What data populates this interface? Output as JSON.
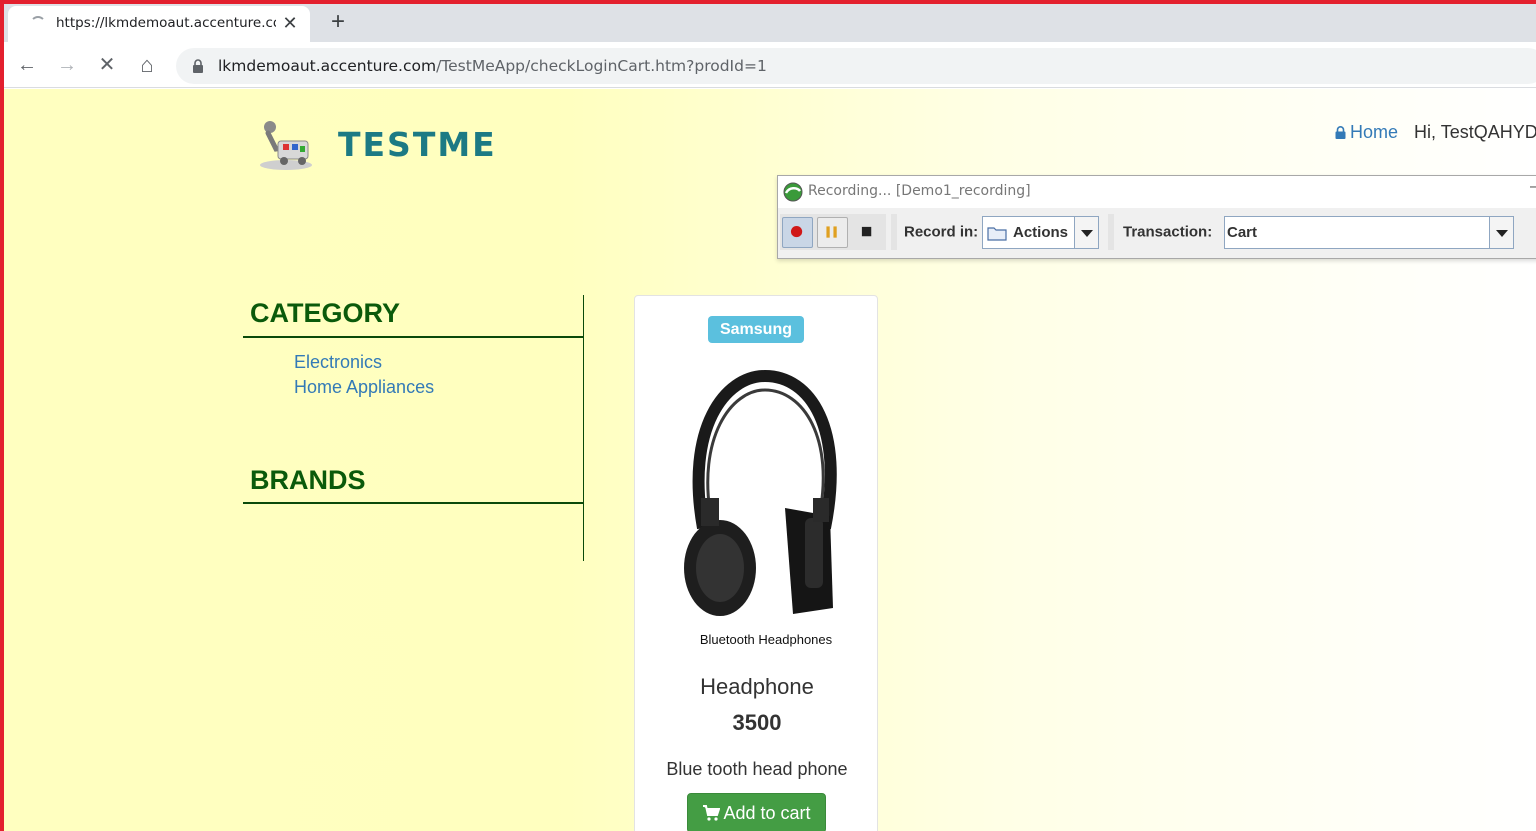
{
  "browser": {
    "tab_title": "https://lkmdemoaut.accenture.com",
    "tab_close": "✕",
    "new_tab": "+",
    "url_host": "lkmdemoaut.accenture.com",
    "url_path": "/TestMeApp/checkLoginCart.htm?prodId=1",
    "back": "←",
    "forward": "→",
    "stop": "✕",
    "home": "⌂"
  },
  "site": {
    "logo_text": "TESTME",
    "home_link": "Home",
    "greeting": "Hi, TestQAHYD"
  },
  "sidebar": {
    "category_heading": "CATEGORY",
    "categories": [
      "Electronics",
      "Home Appliances"
    ],
    "brands_heading": "BRANDS"
  },
  "product": {
    "brand_badge": "Samsung",
    "image_caption": "Bluetooth Headphones",
    "name": "Headphone",
    "price": "3500",
    "description": "Blue tooth head phone",
    "add_to_cart": "Add to cart"
  },
  "recorder": {
    "title": "Recording... [Demo1_recording]",
    "minimize": "–",
    "record_in_label": "Record in:",
    "record_in_value": "Actions",
    "transaction_label": "Transaction:",
    "transaction_value": "Cart"
  },
  "colors": {
    "accent_link": "#337ab7",
    "heading_green": "#0b5a0b",
    "badge": "#5bc0de",
    "cart_button": "#449d44",
    "logo": "#1c7a84"
  }
}
